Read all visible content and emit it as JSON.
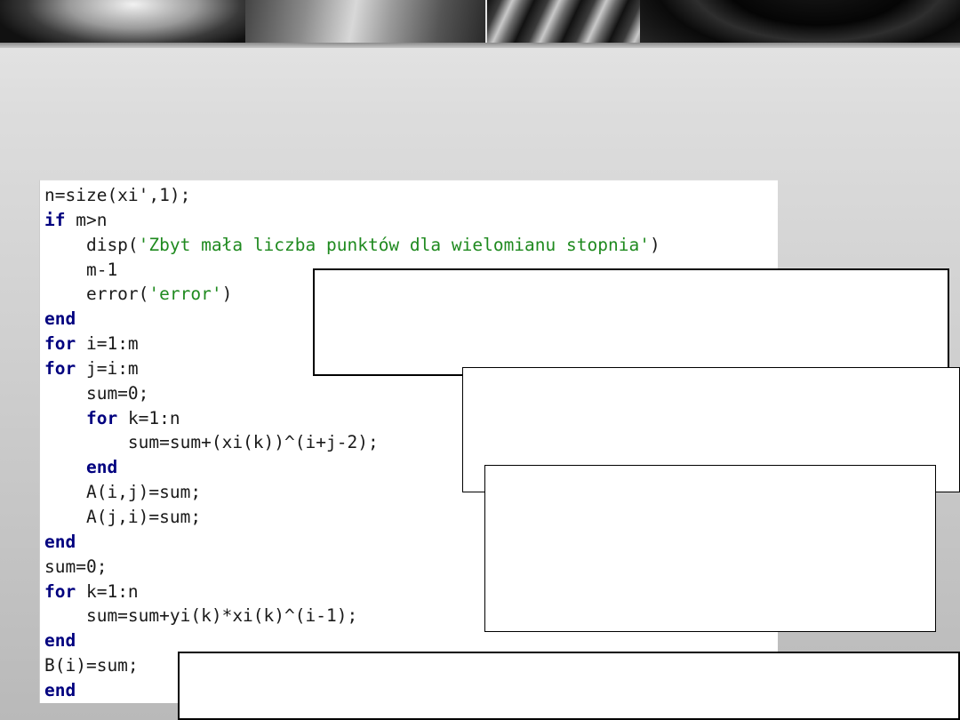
{
  "code_lines": [
    [
      {
        "t": "n=size(xi",
        "c": ""
      },
      {
        "t": "'",
        "c": ""
      },
      {
        "t": ",1);",
        "c": ""
      }
    ],
    [
      {
        "t": "if",
        "c": "kw"
      },
      {
        "t": " m>n",
        "c": ""
      }
    ],
    [
      {
        "t": "    disp(",
        "c": ""
      },
      {
        "t": "'Zbyt mała liczba punktów dla wielomianu stopnia'",
        "c": "str"
      },
      {
        "t": ")",
        "c": ""
      }
    ],
    [
      {
        "t": "    m-1",
        "c": ""
      }
    ],
    [
      {
        "t": "    error(",
        "c": ""
      },
      {
        "t": "'error'",
        "c": "str"
      },
      {
        "t": ")",
        "c": ""
      }
    ],
    [
      {
        "t": "end",
        "c": "kw"
      }
    ],
    [
      {
        "t": "for",
        "c": "kw"
      },
      {
        "t": " i=1:m",
        "c": ""
      }
    ],
    [
      {
        "t": "for",
        "c": "kw"
      },
      {
        "t": " j=i:m",
        "c": ""
      }
    ],
    [
      {
        "t": "    sum=0;",
        "c": ""
      }
    ],
    [
      {
        "t": "    ",
        "c": ""
      },
      {
        "t": "for",
        "c": "kw"
      },
      {
        "t": " k=1:n",
        "c": ""
      }
    ],
    [
      {
        "t": "        sum=sum+(xi(k))^(i+j-2);",
        "c": ""
      }
    ],
    [
      {
        "t": "    ",
        "c": ""
      },
      {
        "t": "end",
        "c": "kw"
      }
    ],
    [
      {
        "t": "    A(i,j)=sum;",
        "c": ""
      }
    ],
    [
      {
        "t": "    A(j,i)=sum;",
        "c": ""
      }
    ],
    [
      {
        "t": "end",
        "c": "kw"
      }
    ],
    [
      {
        "t": "sum=0;",
        "c": ""
      }
    ],
    [
      {
        "t": "for",
        "c": "kw"
      },
      {
        "t": " k=1:n",
        "c": ""
      }
    ],
    [
      {
        "t": "    sum=sum+yi(k)*xi(k)^(i-1);",
        "c": ""
      }
    ],
    [
      {
        "t": "end",
        "c": "kw"
      }
    ],
    [
      {
        "t": "B(i)=sum;",
        "c": ""
      }
    ],
    [
      {
        "t": "end",
        "c": "kw"
      }
    ]
  ],
  "colors": {
    "keyword": "#00007f",
    "string": "#1f8a1f",
    "text": "#1a1a1a"
  }
}
